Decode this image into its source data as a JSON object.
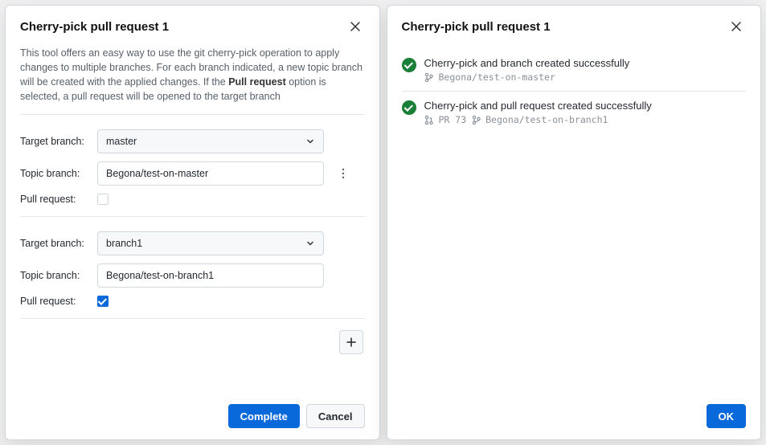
{
  "left": {
    "title": "Cherry-pick pull request 1",
    "intro_pre": "This tool offers an easy way to use the git cherry-pick operation to apply changes to multiple branches. For each branch indicated, a new topic branch will be created with the applied changes. If the ",
    "intro_bold": "Pull request",
    "intro_post": " option is selected, a pull request will be opened to the target branch",
    "labels": {
      "target": "Target branch:",
      "topic": "Topic branch:",
      "pr": "Pull request:"
    },
    "groups": [
      {
        "target": "master",
        "topic": "Begona/test-on-master",
        "pr_checked": false
      },
      {
        "target": "branch1",
        "topic": "Begona/test-on-branch1",
        "pr_checked": true
      }
    ],
    "footer": {
      "complete": "Complete",
      "cancel": "Cancel"
    }
  },
  "right": {
    "title": "Cherry-pick pull request 1",
    "results": [
      {
        "text": "Cherry-pick and branch created successfully",
        "meta": [
          {
            "icon": "branch",
            "label": "Begona/test-on-master"
          }
        ]
      },
      {
        "text": "Cherry-pick and pull request created successfully",
        "meta": [
          {
            "icon": "pr",
            "label": "PR 73"
          },
          {
            "icon": "branch",
            "label": "Begona/test-on-branch1"
          }
        ]
      }
    ],
    "footer": {
      "ok": "OK"
    }
  }
}
